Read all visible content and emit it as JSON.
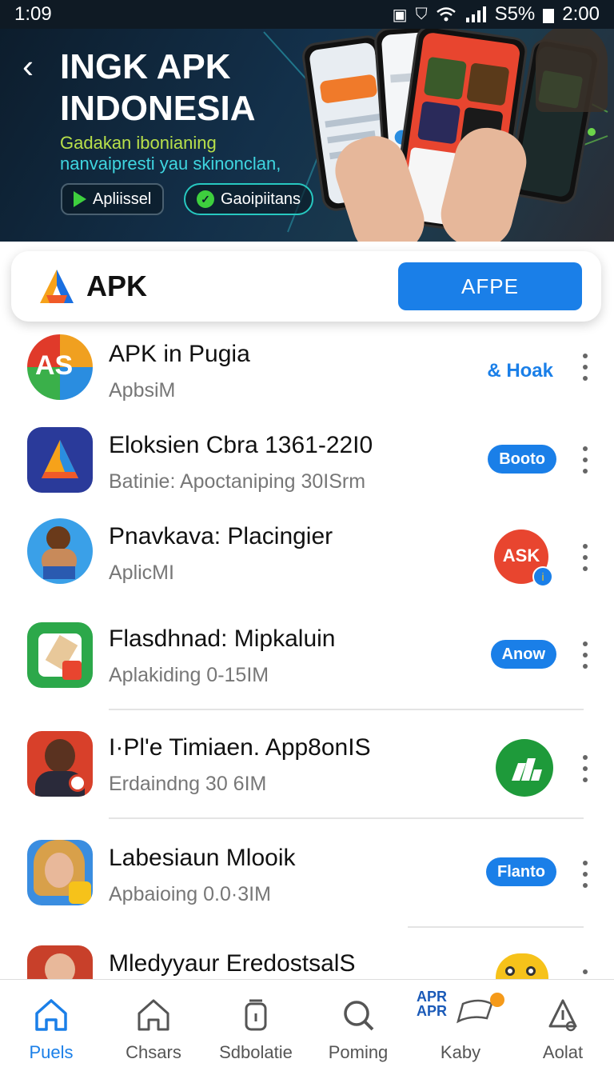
{
  "status": {
    "time": "1:09",
    "battery_text": "S5%",
    "clock": "2:00"
  },
  "hero": {
    "title_line1": "INGK APK",
    "title_line2": "INDONESIA",
    "subtitle_line1": "Gadakan ibonianing",
    "subtitle_line2": "nanvaipresti yau skinonclan,",
    "button1": "Apliissel",
    "button2": "Gaoipiitans"
  },
  "search": {
    "title": "APK",
    "button": "AFPE"
  },
  "apps": [
    {
      "name": "APK in Pugia",
      "meta": "ApbsiM",
      "action": "& Hoak",
      "action_type": "link",
      "icon": "as-logo-icon"
    },
    {
      "name": "Eloksien Cbra 1361-22I0",
      "meta": "Batinie: Apoctaniping 30ISrm",
      "action": "Booto",
      "action_type": "pill",
      "icon": "triangle-a-logo-icon"
    },
    {
      "name": "Pnavkava: Placingier",
      "meta": "AplicMI",
      "action": "ASK",
      "action_type": "circle",
      "icon": "character-icon"
    },
    {
      "name": "Flasdhnad: Mipkaluin",
      "meta": "Aplakiding 0-15IM",
      "action": "Anow",
      "action_type": "pill",
      "icon": "hammer-app-icon"
    },
    {
      "name": "I·Pl'e Timiaen. App8onIS",
      "meta": "Erdaindng 30 6IM",
      "action": "",
      "action_type": "circle-green",
      "icon": "person-portrait-icon"
    },
    {
      "name": "Labesiaun Mlooik",
      "meta": "Apbaioing 0.0·3IM",
      "action": "Flanto",
      "action_type": "pill",
      "icon": "woman-portrait-icon"
    },
    {
      "name": "Mledyyaur EredostsalS",
      "meta": "",
      "action": "",
      "action_type": "mascot",
      "icon": "man-portrait-icon"
    }
  ],
  "nav": [
    {
      "label": "Puels",
      "icon": "home-icon"
    },
    {
      "label": "Chsars",
      "icon": "house-outline-icon"
    },
    {
      "label": "Sdbolatie",
      "icon": "jar-icon"
    },
    {
      "label": "Poming",
      "icon": "magnifier-icon"
    },
    {
      "label": "Kaby",
      "icon": "apr-badge-icon",
      "badge_text1": "APR",
      "badge_text2": "APR"
    },
    {
      "label": "Aolat",
      "icon": "warning-bell-icon"
    }
  ],
  "colors": {
    "accent": "#1a7fe8",
    "hero_bg": "#0c1c2b",
    "hero_sub1": "#b8e04a",
    "hero_sub2": "#3fd6e0"
  }
}
